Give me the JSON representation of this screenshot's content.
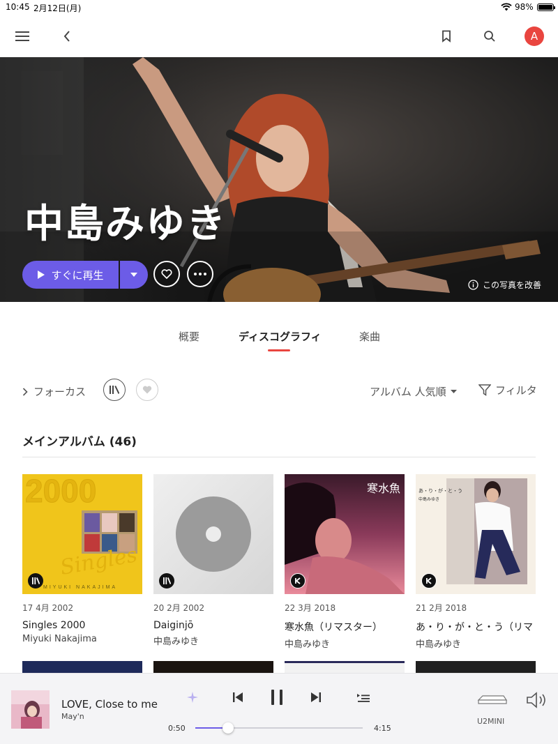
{
  "status_bar": {
    "time": "10:45",
    "date": "2月12日(月)",
    "battery": "98%"
  },
  "hero": {
    "artist_name": "中島みゆき",
    "play_label": "すぐに再生",
    "improve_photo": "この写真を改善"
  },
  "user": {
    "avatar_letter": "A"
  },
  "tabs": [
    {
      "label": "概要"
    },
    {
      "label": "ディスコグラフィ",
      "active": true
    },
    {
      "label": "楽曲"
    }
  ],
  "filters": {
    "focus": "フォーカス",
    "sort": "アルバム 人気順",
    "filter": "フィルタ"
  },
  "section": {
    "title": "メインアルバム (46)"
  },
  "albums": [
    {
      "date": "17 4月 2002",
      "title": "Singles 2000",
      "artist": "Miyuki Nakajima",
      "badge": "library-icon"
    },
    {
      "date": "20 2月 2002",
      "title": "Daiginjō",
      "artist": "中島みゆき",
      "badge": "library-icon"
    },
    {
      "date": "22 3月 2018",
      "title": "寒水魚（リマスター）",
      "artist": "中島みゆき",
      "badge": "kkbox-icon"
    },
    {
      "date": "21 2月 2018",
      "title": "あ・り・が・と・う（リマ",
      "artist": "中島みゆき",
      "badge": "kkbox-icon"
    }
  ],
  "cover_text": {
    "singles_year": "2000",
    "singles_script": "Singles",
    "singles_credit": "MIYUKI NAKAJIMA",
    "kansuigyo": "寒水魚",
    "arigatou": "あ・り・が・と・う",
    "arigatou_artist": "中島みゆき"
  },
  "player": {
    "title": "LOVE, Close to me",
    "artist": "May'n",
    "elapsed": "0:50",
    "total": "4:15",
    "progress": 0.196,
    "device": "U2MINI"
  },
  "colors": {
    "accent": "#6c5ce7",
    "brand_red": "#e9453f"
  }
}
